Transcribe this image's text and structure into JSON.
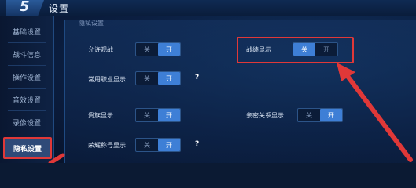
{
  "header": {
    "back_glyph": "5",
    "title": "设置"
  },
  "sidebar": {
    "items": [
      {
        "label": "基础设置"
      },
      {
        "label": "战斗信息"
      },
      {
        "label": "操作设置"
      },
      {
        "label": "音效设置"
      },
      {
        "label": "录像设置"
      },
      {
        "label": "隐私设置"
      }
    ],
    "active_index": 5
  },
  "section": {
    "title": "隐私设置"
  },
  "toggle_text": {
    "off": "关",
    "on": "开"
  },
  "settings": {
    "allow_spectate": {
      "label": "允许观战",
      "state": "on"
    },
    "combat_display": {
      "label": "战绩显示",
      "state": "off"
    },
    "common_roles": {
      "label": "常用职业显示",
      "state": "on",
      "help": "?"
    },
    "nobility": {
      "label": "贵族显示",
      "state": "on"
    },
    "close_relation": {
      "label": "亲密关系显示",
      "state": "on"
    },
    "honor_title": {
      "label": "荣耀称号显示",
      "state": "on",
      "help": "?"
    }
  },
  "colors": {
    "accent": "#3e7fd6",
    "annotation": "#e03838",
    "background": "#0b1f42"
  }
}
